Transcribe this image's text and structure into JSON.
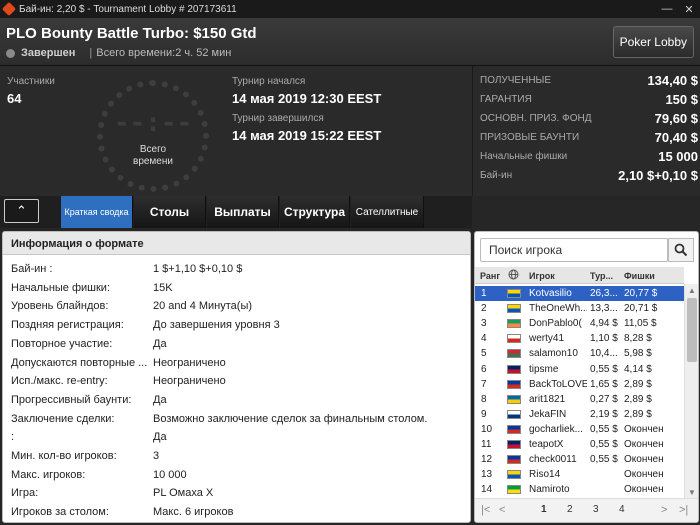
{
  "window": {
    "title": "Бай-ин: 2,20 $ - Tournament Lobby # 207173611",
    "minimize": "—",
    "close": "✕"
  },
  "header": {
    "title": "PLO Bounty Battle Turbo: $150 Gtd",
    "state": "Завершен",
    "separator": "|",
    "total_time": "Всего времени:2 ч. 52 мин",
    "lobby_button": "Poker Lobby"
  },
  "info": {
    "participants_label": "Участники",
    "participants_value": "64",
    "clock_time": "--:--",
    "clock_label_1": "Всего",
    "clock_label_2": "времени",
    "start_label": "Турнир начался",
    "start_value": "14 мая 2019  12:30 EEST",
    "end_label": "Турнир завершился",
    "end_value": "14 мая 2019  15:22 EEST"
  },
  "stats": [
    {
      "key": "ПОЛУЧЕННЫЕ",
      "value": "134,40 $"
    },
    {
      "key": "ГАРАНТИЯ",
      "value": "150 $"
    },
    {
      "key": "ОСНОВН. ПРИЗ. ФОНД",
      "value": "79,60 $"
    },
    {
      "key": "ПРИЗОВЫЕ БАУНТИ",
      "value": "70,40 $"
    },
    {
      "key": "Начальные фишки",
      "value": "15 000"
    },
    {
      "key": "Бай-ин",
      "value": "2,10 $+0,10 $"
    }
  ],
  "tabs": {
    "collapse": "⌃",
    "summary": "Краткая сводка",
    "tables": "Столы",
    "payouts": "Выплаты",
    "structure": "Структура",
    "satellites": "Сателлитные"
  },
  "format": {
    "heading": "Информация о формате",
    "rows": [
      {
        "key": "Бай-ин :",
        "value": "1 $+1,10 $+0,10 $"
      },
      {
        "key": "Начальные фишки:",
        "value": "15K"
      },
      {
        "key": "Уровень блайндов:",
        "value": "20 and 4 Минута(ы)"
      },
      {
        "key": "Поздняя регистрация:",
        "value": "До завершения уровня 3"
      },
      {
        "key": "Повторное участие:",
        "value": "Да"
      },
      {
        "key": "Допускаются повторные ...",
        "value": "Неограничено"
      },
      {
        "key": "Исп./макс. re-entry:",
        "value": "Неограничено"
      },
      {
        "key": "Прогрессивный баунти:",
        "value": "Да"
      },
      {
        "key": "Заключение сделки:",
        "value": "Возможно заключение сделок за финальным столом."
      },
      {
        "key": ":",
        "value": "Да"
      },
      {
        "key": "Мин. кол-во игроков:",
        "value": "3"
      },
      {
        "key": "Макс. игроков:",
        "value": "10 000"
      },
      {
        "key": "Игра:",
        "value": "PL Омаха X"
      },
      {
        "key": "Игроков за столом:",
        "value": "Макс. 6 игроков"
      }
    ]
  },
  "players": {
    "search_placeholder": "Поиск игрока",
    "headers": {
      "rank": "Ранг",
      "player": "Игрок",
      "bounty": "Тур...",
      "chips": "Фишки"
    },
    "rows": [
      {
        "rank": "1",
        "name": "Kotvasilio",
        "bounty": "26,3...",
        "chips": "20,77 $",
        "flag": [
          "#ffd500",
          "#0057b7"
        ]
      },
      {
        "rank": "2",
        "name": "TheOneWh...",
        "bounty": "13,3...",
        "chips": "20,71 $",
        "flag": [
          "#ffd500",
          "#0057b7"
        ]
      },
      {
        "rank": "3",
        "name": "DonPablo0(",
        "bounty": "4,94 $",
        "chips": "11,05 $",
        "flag": [
          "#169b62",
          "#ff883e"
        ]
      },
      {
        "rank": "4",
        "name": "werty41",
        "bounty": "1,10 $",
        "chips": "8,28 $",
        "flag": [
          "#ffffff",
          "#d52b1e"
        ]
      },
      {
        "rank": "5",
        "name": "salamon10",
        "bounty": "10,4...",
        "chips": "5,98 $",
        "flag": [
          "#ce2939",
          "#477050"
        ]
      },
      {
        "rank": "6",
        "name": "tipsme",
        "bounty": "0,55 $",
        "chips": "4,14 $",
        "flag": [
          "#012169",
          "#c8102e"
        ]
      },
      {
        "rank": "7",
        "name": "BackToLOVE",
        "bounty": "1,65 $",
        "chips": "2,89 $",
        "flag": [
          "#0039a6",
          "#d52b1e"
        ]
      },
      {
        "rank": "8",
        "name": "arit1821",
        "bounty": "0,27 $",
        "chips": "2,89 $",
        "flag": [
          "#006aa7",
          "#fecc00"
        ]
      },
      {
        "rank": "9",
        "name": "JekaFIN",
        "bounty": "2,19 $",
        "chips": "2,89 $",
        "flag": [
          "#ffffff",
          "#003580"
        ]
      },
      {
        "rank": "10",
        "name": "gocharliek...",
        "bounty": "0,55 $",
        "chips": "Окончен",
        "flag": [
          "#0039a6",
          "#d52b1e"
        ]
      },
      {
        "rank": "11",
        "name": "teapotX",
        "bounty": "0,55 $",
        "chips": "Окончен",
        "flag": [
          "#012169",
          "#c8102e"
        ]
      },
      {
        "rank": "12",
        "name": "check0011",
        "bounty": "0,55 $",
        "chips": "Окончен",
        "flag": [
          "#0039a6",
          "#d52b1e"
        ]
      },
      {
        "rank": "13",
        "name": "Riso14",
        "bounty": "",
        "chips": "Окончен",
        "flag": [
          "#ffd500",
          "#0057b7"
        ]
      },
      {
        "rank": "14",
        "name": "Namiroto",
        "bounty": "",
        "chips": "Окончен",
        "flag": [
          "#009c3b",
          "#ffdf00"
        ]
      }
    ],
    "pager": {
      "first": "|<",
      "prev": "<",
      "p1": "1",
      "p2": "2",
      "p3": "3",
      "p4": "4",
      "next": ">",
      "last": ">|"
    }
  }
}
